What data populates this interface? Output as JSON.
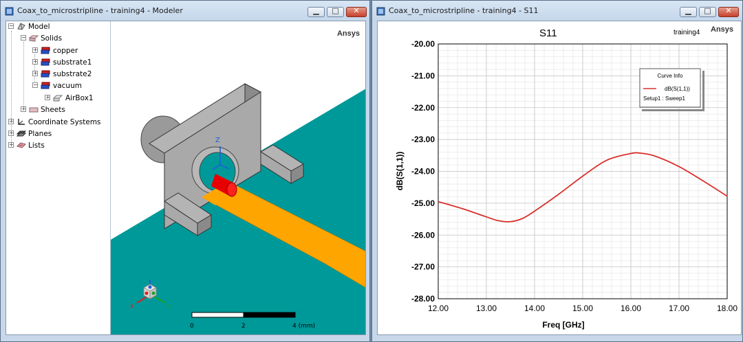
{
  "modeler": {
    "title": "Coax_to_microstripline - training4 - Modeler",
    "brand": "Ansys",
    "tree": [
      {
        "label": "Model",
        "icon": "model-icon"
      },
      {
        "label": "Solids",
        "icon": "solids-icon"
      },
      {
        "label": "copper",
        "icon": "solid-object-icon"
      },
      {
        "label": "substrate1",
        "icon": "solid-object-icon"
      },
      {
        "label": "substrate2",
        "icon": "solid-object-icon"
      },
      {
        "label": "vacuum",
        "icon": "solid-object-icon"
      },
      {
        "label": "AirBox1",
        "icon": "airbox-icon"
      },
      {
        "label": "Sheets",
        "icon": "sheets-icon"
      },
      {
        "label": "Coordinate Systems",
        "icon": "coordinate-systems-icon"
      },
      {
        "label": "Planes",
        "icon": "planes-icon"
      },
      {
        "label": "Lists",
        "icon": "lists-icon"
      }
    ],
    "scale": {
      "t0": "0",
      "t1": "2",
      "t2": "4 (mm)"
    },
    "axes": {
      "x": "X",
      "y": "Y",
      "z": "Z"
    },
    "colors": {
      "substrate": "#009999",
      "strip": "#ffa500",
      "connector": "#a9a9a9",
      "pin": "#ff0000"
    }
  },
  "plot_window": {
    "title": "Coax_to_microstripline - training4 - S11",
    "brand": "Ansys",
    "design_label": "training4",
    "curve_info": {
      "heading": "Curve Info",
      "trace": "dB(S(1,1))",
      "setup": "Setup1 : Sweep1"
    }
  },
  "chart_data": {
    "type": "line",
    "title": "S11",
    "xlabel": "Freq [GHz]",
    "ylabel": "dB(S(1,1))",
    "xlim": [
      12.0,
      18.0
    ],
    "ylim": [
      -28.0,
      -20.0
    ],
    "xticks": [
      "12.00",
      "13.00",
      "14.00",
      "15.00",
      "16.00",
      "17.00",
      "18.00"
    ],
    "yticks": [
      "-20.00",
      "-21.00",
      "-22.00",
      "-23.00",
      "-24.00",
      "-25.00",
      "-26.00",
      "-27.00",
      "-28.00"
    ],
    "grid": true,
    "legend_position": "top-right",
    "series": [
      {
        "name": "dB(S(1,1))",
        "color": "#d9302b",
        "x": [
          12.0,
          12.5,
          13.0,
          13.25,
          13.5,
          13.75,
          14.0,
          14.5,
          15.0,
          15.5,
          16.0,
          16.2,
          16.5,
          17.0,
          17.5,
          18.0
        ],
        "y": [
          -24.95,
          -25.17,
          -25.43,
          -25.55,
          -25.58,
          -25.48,
          -25.25,
          -24.72,
          -24.15,
          -23.65,
          -23.44,
          -23.43,
          -23.52,
          -23.85,
          -24.3,
          -24.78
        ]
      }
    ]
  }
}
